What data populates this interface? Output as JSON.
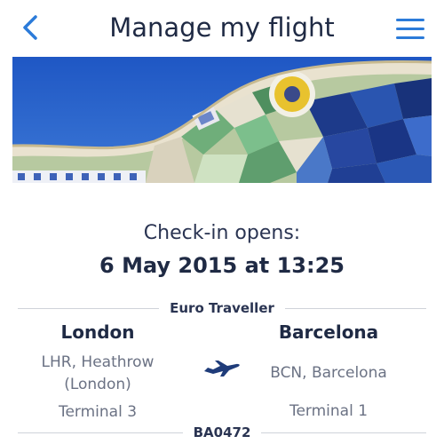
{
  "header": {
    "title": "Manage my flight",
    "back_icon": "chevron-left-icon",
    "menu_icon": "hamburger-menu-icon"
  },
  "colors": {
    "accent": "#2b7bd9",
    "text_primary": "#1f2a44",
    "text_secondary": "#6b7284",
    "divider": "#cfd3da"
  },
  "checkin": {
    "label": "Check-in opens:",
    "date": "6 May 2015 at 13:25"
  },
  "flight": {
    "cabin": "Euro Traveller",
    "number": "BA0472",
    "origin": {
      "city": "London",
      "airport_line1": "LHR, Heathrow",
      "airport_line2": "(London)",
      "terminal": "Terminal 3"
    },
    "destination": {
      "city": "Barcelona",
      "airport": "BCN, Barcelona",
      "terminal": "Terminal 1"
    },
    "plane_icon": "airplane-icon"
  }
}
